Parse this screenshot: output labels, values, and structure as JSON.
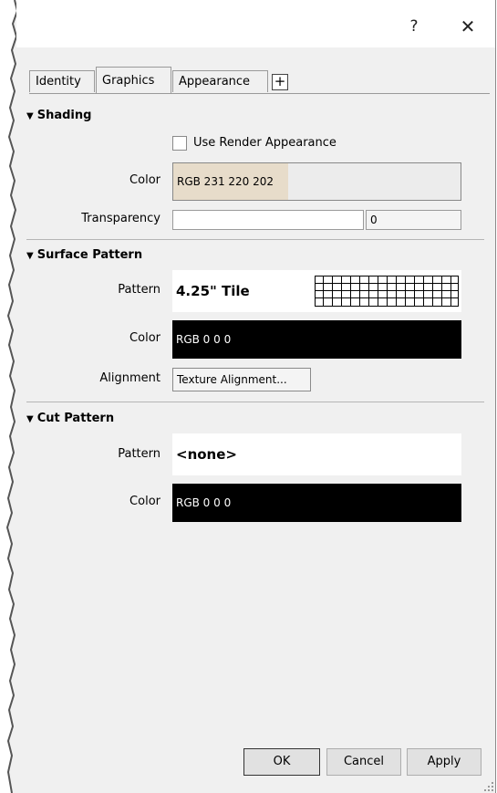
{
  "titlebar": {
    "help_label": "?",
    "close_label": "✕"
  },
  "tabs": [
    {
      "label": "Identity",
      "active": false
    },
    {
      "label": "Graphics",
      "active": true
    },
    {
      "label": "Appearance",
      "active": false
    }
  ],
  "tab_add_label": "+",
  "shading": {
    "header": "Shading",
    "use_render_label": "Use Render Appearance",
    "use_render_checked": false,
    "color_label": "Color",
    "color_value": "RGB 231 220 202",
    "color_hex": "#e7dcca",
    "transparency_label": "Transparency",
    "transparency_value": "0"
  },
  "surface_pattern": {
    "header": "Surface Pattern",
    "pattern_label": "Pattern",
    "pattern_value": "4.25\" Tile",
    "color_label": "Color",
    "color_value": "RGB 0 0 0",
    "alignment_label": "Alignment",
    "alignment_button": "Texture Alignment..."
  },
  "cut_pattern": {
    "header": "Cut Pattern",
    "pattern_label": "Pattern",
    "pattern_value": "<none>",
    "color_label": "Color",
    "color_value": "RGB 0 0 0"
  },
  "buttons": {
    "ok": "OK",
    "cancel": "Cancel",
    "apply": "Apply"
  }
}
